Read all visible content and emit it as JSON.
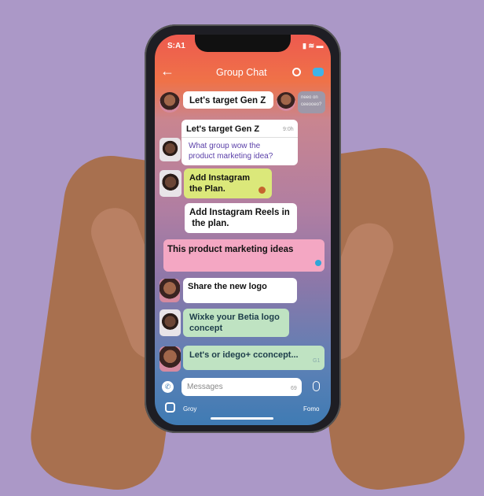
{
  "status": {
    "time": "S:A1"
  },
  "header": {
    "title": "Group Chat",
    "back_icon": "arrow-left-icon",
    "search_icon": "search-icon",
    "chat_icon": "chat-bubble-icon"
  },
  "messages": [
    {
      "text": "Let's target Gen Z"
    },
    {
      "text": "neeo on\nceeooeo?"
    },
    {
      "title": "Let's target Gen Z",
      "time": "9:0h",
      "body": "What group wow the\nproduct marketing idea?"
    },
    {
      "text": "Add Instagram\nthe Plan."
    },
    {
      "text": "Add Instagram Reels in\n the plan."
    },
    {
      "text": "This product marketing ideas"
    },
    {
      "text": "Share the new logo"
    },
    {
      "text": "Wixke your Betia logo\nconcept"
    },
    {
      "text": "Let's or idego+ cconcept...",
      "time": "G1"
    }
  ],
  "composer": {
    "placeholder": "Messages",
    "count": "69"
  },
  "bottom": {
    "left_label": "Groy",
    "right_label": "Fomo"
  },
  "colors": {
    "background": "#ab98c7",
    "header_top": "#ee5a4f",
    "bottom": "#3f7bb4",
    "yellow_bubble": "#dbe87a",
    "pink_bubble": "#f4a7c3",
    "green_bubble": "#bfe3c2"
  }
}
